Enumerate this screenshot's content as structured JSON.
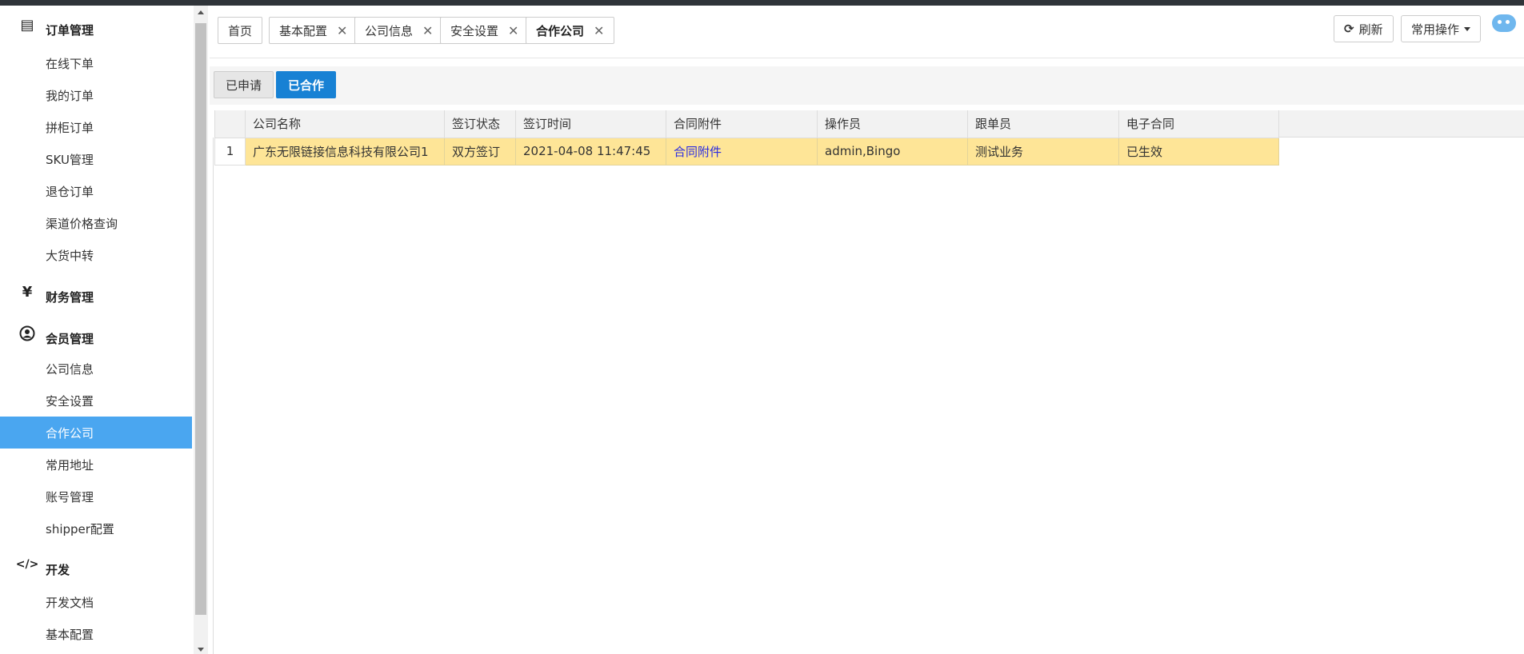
{
  "sidebar": {
    "groups": [
      {
        "label": "订单管理",
        "icon": "order-list-icon",
        "glyph": "▤"
      },
      {
        "label": "财务管理",
        "icon": "yen-icon",
        "glyph": "¥"
      },
      {
        "label": "会员管理",
        "icon": "user-icon",
        "glyph": "●"
      },
      {
        "label": "开发",
        "icon": "code-icon",
        "glyph": "</>"
      }
    ],
    "order_items": [
      "在线下单",
      "我的订单",
      "拼柜订单",
      "SKU管理",
      "退仓订单",
      "渠道价格查询",
      "大货中转"
    ],
    "member_items": [
      "公司信息",
      "安全设置",
      "合作公司",
      "常用地址",
      "账号管理",
      "shipper配置"
    ],
    "dev_items": [
      "开发文档",
      "基本配置"
    ],
    "active_item": "合作公司"
  },
  "tabs": [
    {
      "label": "首页",
      "closable": false
    },
    {
      "label": "基本配置",
      "closable": true
    },
    {
      "label": "公司信息",
      "closable": true
    },
    {
      "label": "安全设置",
      "closable": true
    },
    {
      "label": "合作公司",
      "closable": true,
      "active": true
    }
  ],
  "toolbar": {
    "refresh_label": "刷新",
    "common_ops_label": "常用操作"
  },
  "subtabs": {
    "applied_label": "已申请",
    "cooperated_label": "已合作"
  },
  "grid": {
    "columns": [
      "公司名称",
      "签订状态",
      "签订时间",
      "合同附件",
      "操作员",
      "跟单员",
      "电子合同"
    ],
    "rows": [
      {
        "index": "1",
        "company": "广东无限链接信息科技有限公司1",
        "status": "双方签订",
        "time": "2021-04-08 11:47:45",
        "attachment": "合同附件",
        "operator": "admin,Bingo",
        "follower": "测试业务",
        "contract": "已生效"
      }
    ]
  },
  "colors": {
    "active_menu": "#4aa6f0",
    "primary_button": "#1781d4",
    "selected_row": "#fee597",
    "link": "#2d2de0"
  }
}
